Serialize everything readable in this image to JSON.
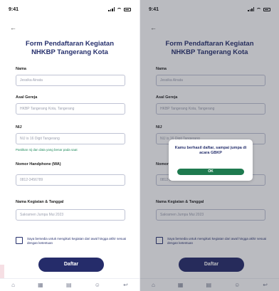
{
  "status_bar": {
    "time": "9:41"
  },
  "form": {
    "title_line1": "Form Pendaftaran Kegiatan",
    "title_line2": "NHKBP Tangerang Kota",
    "fields": [
      {
        "label": "Nama",
        "placeholder": "Jessika Ainata"
      },
      {
        "label": "Asal Gereja",
        "placeholder": "HKBP Tangerang Kota, Tangerang"
      },
      {
        "label": "NIJ",
        "placeholder": "NIJ is 16 Digit Tangerang"
      },
      {
        "label": "Nomor Handphone (WA)",
        "placeholder": "0812-3456789"
      },
      {
        "label": "Nama Kegiatan & Tanggal",
        "placeholder": "Sakramen Jumpa Mui 2023"
      }
    ],
    "nij_hint": "Pastikan nij dan data yang benar pada saat",
    "checkbox_text": "Saya bersedia untuk mengikuti kegiatan dari awal hingga akhir sesuai dengan ketentuan",
    "submit_label": "Daftar"
  },
  "dialog": {
    "message": "Kamu berhasil daftar, sampai jumpa di acara GBKP",
    "ok_label": "OK"
  },
  "nav_icons": [
    "home-icon",
    "calendar-icon",
    "news-icon",
    "profile-icon",
    "back-icon"
  ]
}
